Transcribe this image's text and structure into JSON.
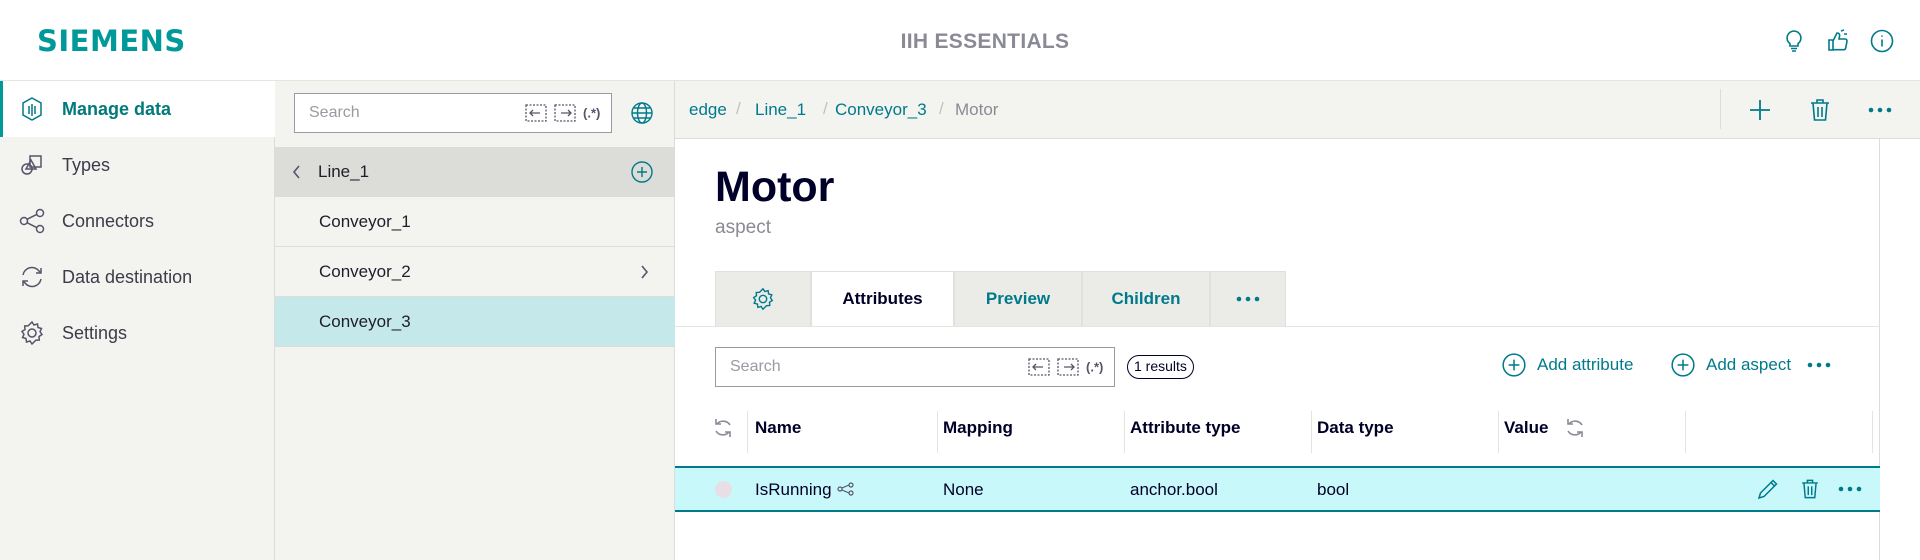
{
  "header": {
    "brand": "SIEMENS",
    "app_title": "IIH ESSENTIALS",
    "icons": [
      "lightbulb-icon",
      "feedback-icon",
      "info-icon"
    ]
  },
  "nav": {
    "items": [
      {
        "label": "Manage data",
        "icon": "manage-data-icon",
        "active": true
      },
      {
        "label": "Types",
        "icon": "types-icon"
      },
      {
        "label": "Connectors",
        "icon": "connectors-icon"
      },
      {
        "label": "Data destination",
        "icon": "data-destination-icon"
      },
      {
        "label": "Settings",
        "icon": "settings-icon"
      }
    ]
  },
  "tree": {
    "search_placeholder": "Search",
    "search_regex_label": "(.*)",
    "parent": "Line_1",
    "items": [
      {
        "label": "Conveyor_1"
      },
      {
        "label": "Conveyor_2",
        "has_children": true
      },
      {
        "label": "Conveyor_3",
        "selected": true
      }
    ]
  },
  "breadcrumb": {
    "items": [
      "edge",
      "Line_1",
      "Conveyor_3",
      "Motor"
    ],
    "separator": "/"
  },
  "detail": {
    "title": "Motor",
    "subtitle": "aspect",
    "tabs": [
      {
        "label": "",
        "icon": "gear-icon"
      },
      {
        "label": "Attributes",
        "active": true
      },
      {
        "label": "Preview"
      },
      {
        "label": "Children"
      },
      {
        "label": "",
        "icon": "more-icon"
      }
    ],
    "search_placeholder": "Search",
    "search_regex_label": "(.*)",
    "results_count": "1 results",
    "add_attribute_label": "Add attribute",
    "add_aspect_label": "Add aspect"
  },
  "table": {
    "columns": [
      "Name",
      "Mapping",
      "Attribute type",
      "Data type",
      "Value"
    ],
    "rows": [
      {
        "name": "IsRunning",
        "mapping": "None",
        "attribute_type": "anchor.bool",
        "data_type": "bool",
        "value": ""
      }
    ]
  },
  "colors": {
    "brand": "#009999",
    "accent": "#007a8a",
    "selected_row": "#c8f8fa",
    "selected_tree": "#c5e8ea",
    "panel_bg": "#f3f3f0"
  }
}
